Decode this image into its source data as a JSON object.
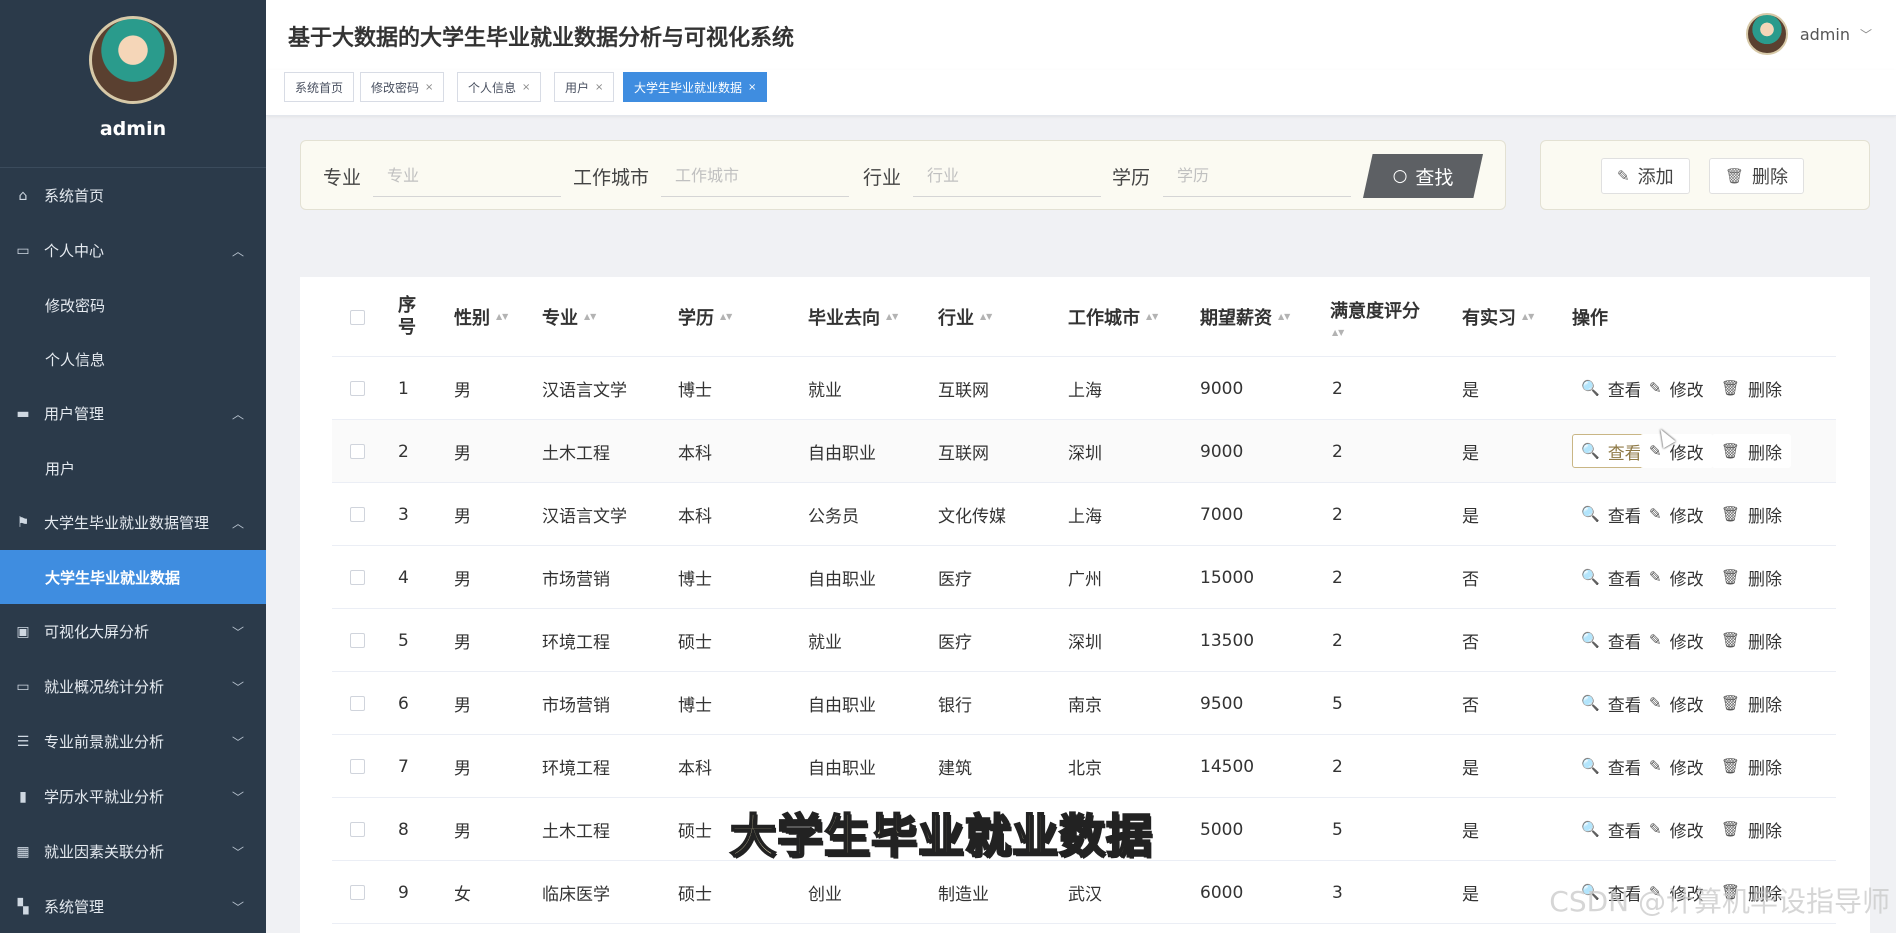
{
  "sidebar": {
    "user": "admin",
    "items": [
      {
        "label": "系统首页",
        "icon": "home-icon"
      },
      {
        "label": "个人中心",
        "icon": "card-icon",
        "sub": [
          "修改密码",
          "个人信息"
        ]
      },
      {
        "label": "用户管理",
        "icon": "briefcase-icon",
        "sub": [
          "用户"
        ]
      },
      {
        "label": "大学生毕业就业数据管理",
        "icon": "flag-icon",
        "sub": [
          "大学生毕业就业数据"
        ]
      },
      {
        "label": "可视化大屏分析",
        "icon": "clipboard-icon"
      },
      {
        "label": "就业概况统计分析",
        "icon": "monitor-icon"
      },
      {
        "label": "专业前景就业分析",
        "icon": "sliders-icon"
      },
      {
        "label": "学历水平就业分析",
        "icon": "bars-icon"
      },
      {
        "label": "就业因素关联分析",
        "icon": "grid-icon"
      },
      {
        "label": "系统管理",
        "icon": "apps-icon"
      }
    ]
  },
  "header": {
    "title": "基于大数据的大学生毕业就业数据分析与可视化系统",
    "user": "admin"
  },
  "tabs": [
    {
      "label": "系统首页",
      "closable": false
    },
    {
      "label": "修改密码",
      "closable": true
    },
    {
      "label": "个人信息",
      "closable": true
    },
    {
      "label": "用户",
      "closable": true
    },
    {
      "label": "大学生毕业就业数据",
      "closable": true,
      "active": true
    }
  ],
  "search": {
    "fields": [
      {
        "label": "专业",
        "placeholder": "专业"
      },
      {
        "label": "工作城市",
        "placeholder": "工作城市"
      },
      {
        "label": "行业",
        "placeholder": "行业"
      },
      {
        "label": "学历",
        "placeholder": "学历"
      }
    ],
    "button": "查找"
  },
  "actions": {
    "add": "添加",
    "delete": "删除"
  },
  "table": {
    "headers": [
      "序号",
      "性别",
      "专业",
      "学历",
      "毕业去向",
      "行业",
      "工作城市",
      "期望薪资",
      "满意度评分",
      "有实习",
      "操作"
    ],
    "ops": {
      "view": "查看",
      "edit": "修改",
      "delete": "删除"
    },
    "rows": [
      [
        "1",
        "男",
        "汉语言文学",
        "博士",
        "就业",
        "互联网",
        "上海",
        "9000",
        "2",
        "是"
      ],
      [
        "2",
        "男",
        "土木工程",
        "本科",
        "自由职业",
        "互联网",
        "深圳",
        "9000",
        "2",
        "是"
      ],
      [
        "3",
        "男",
        "汉语言文学",
        "本科",
        "公务员",
        "文化传媒",
        "上海",
        "7000",
        "2",
        "是"
      ],
      [
        "4",
        "男",
        "市场营销",
        "博士",
        "自由职业",
        "医疗",
        "广州",
        "15000",
        "2",
        "否"
      ],
      [
        "5",
        "男",
        "环境工程",
        "硕士",
        "就业",
        "医疗",
        "深圳",
        "13500",
        "2",
        "否"
      ],
      [
        "6",
        "男",
        "市场营销",
        "博士",
        "自由职业",
        "银行",
        "南京",
        "9500",
        "5",
        "否"
      ],
      [
        "7",
        "男",
        "环境工程",
        "本科",
        "自由职业",
        "建筑",
        "北京",
        "14500",
        "2",
        "是"
      ],
      [
        "8",
        "男",
        "土木工程",
        "硕士",
        "",
        "",
        "",
        "5000",
        "5",
        "是"
      ],
      [
        "9",
        "女",
        "临床医学",
        "硕士",
        "创业",
        "制造业",
        "武汉",
        "6000",
        "3",
        "是"
      ]
    ]
  },
  "overlay": {
    "caption": "大学生毕业就业数据",
    "watermark": "CSDN @计算机毕设指导师"
  }
}
